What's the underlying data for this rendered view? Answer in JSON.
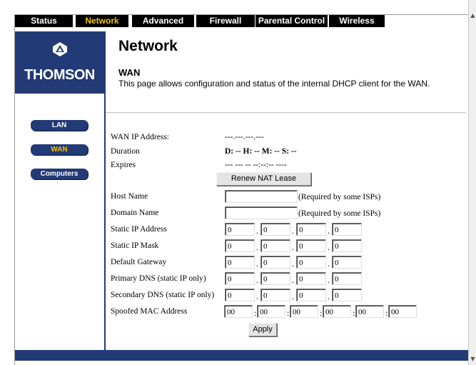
{
  "tabs": [
    {
      "label": "Status",
      "active": false
    },
    {
      "label": "Network",
      "active": true
    },
    {
      "label": "Advanced",
      "active": false
    },
    {
      "label": "Firewall",
      "active": false
    },
    {
      "label": "Parental Control",
      "active": false
    },
    {
      "label": "Wireless",
      "active": false
    }
  ],
  "brand": {
    "name": "THOMSON",
    "icon": "thomson-logo-icon",
    "color": "#223a76"
  },
  "sidebar": {
    "items": [
      {
        "label": "LAN",
        "active": false
      },
      {
        "label": "WAN",
        "active": true
      },
      {
        "label": "Computers",
        "active": false
      }
    ]
  },
  "header": {
    "title": "Network",
    "section": "WAN",
    "description": "This page allows configuration and status of the internal DHCP client for the WAN."
  },
  "status": {
    "wan_ip_label": "WAN IP Address:",
    "wan_ip_value": "---.---.---.---",
    "duration_label": "Duration",
    "duration_value": "D: -- H: -- M: -- S: --",
    "expires_label": "Expires",
    "expires_value": "--- --- -- --:--:-- ----",
    "renew_button": "Renew NAT Lease"
  },
  "form": {
    "host_name_label": "Host Name",
    "host_name_value": "",
    "host_name_note": "(Required by some ISPs)",
    "domain_name_label": "Domain Name",
    "domain_name_value": "",
    "domain_name_note": "(Required by some ISPs)",
    "static_ip_label": "Static IP Address",
    "static_ip": [
      "0",
      "0",
      "0",
      "0"
    ],
    "static_mask_label": "Static IP Mask",
    "static_mask": [
      "0",
      "0",
      "0",
      "0"
    ],
    "gateway_label": "Default Gateway",
    "gateway": [
      "0",
      "0",
      "0",
      "0"
    ],
    "primary_dns_label": "Primary DNS (static IP only)",
    "primary_dns": [
      "0",
      "0",
      "0",
      "0"
    ],
    "secondary_dns_label": "Secondary DNS (static IP only)",
    "secondary_dns": [
      "0",
      "0",
      "0",
      "0"
    ],
    "mac_label": "Spoofed MAC Address",
    "mac": [
      "00",
      "00",
      "00",
      "00",
      "00",
      "00"
    ],
    "ip_separator": ".",
    "mac_separator": ":",
    "apply_button": "Apply"
  },
  "colors": {
    "accent": "#223a76",
    "active_text": "#f2c200",
    "tab_bg": "#000000"
  }
}
